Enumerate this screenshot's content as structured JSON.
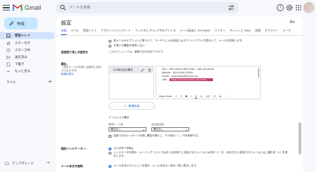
{
  "app": {
    "name": "Gmail",
    "brand_colors": [
      "#ea4335",
      "#4285f4",
      "#34a853",
      "#fbbc04"
    ]
  },
  "search": {
    "placeholder": "メールを検索"
  },
  "sidebar": {
    "compose_label": "作成",
    "items": [
      {
        "label": "受信トレイ",
        "icon": "inbox-icon",
        "active": true
      },
      {
        "label": "スター付き",
        "icon": "star-icon"
      },
      {
        "label": "スヌーズ中",
        "icon": "clock-icon"
      },
      {
        "label": "送信済み",
        "icon": "send-icon"
      },
      {
        "label": "下書き",
        "icon": "draft-icon"
      },
      {
        "label": "もっと見る",
        "icon": "chevron-down-icon"
      }
    ],
    "labels_heading": "ラベル",
    "labels_add": "+",
    "upgrade_label": "アップグレード"
  },
  "main": {
    "title": "設定",
    "tabs": [
      "全般",
      "ラベル",
      "受信トレイ",
      "アカウントとインポート",
      "フィルタとブロック中のアドレス",
      "メール転送と POP/IMAP",
      "アドオン",
      "チャットと Meet",
      "詳細",
      "オフライン",
      "テーマ"
    ],
    "active_tab": "全般",
    "top_option_1": "各メールのオプションに基づいて、ユーザーによる返信にはスマートリプライを表示して、メールを送信します。",
    "top_option_2": "予測入力機能を使用しない",
    "undo_label": "送信取り消しの設定を",
    "undo_link_text": "このセクションでは、編集方法を設定できます。",
    "signature_label": "署名:",
    "signature_sub": "（送信メールの末尾に自動的に追加される文字列）",
    "signature_sub2": "詳細を表示",
    "signature_name": "GIG株式会社署名",
    "signature_lines": [
      "TEL：000-0000-0000 FAX：000-00-0000",
      "Mobile：000-0000-0000",
      "Email：xxxxxxxx@xxxxx.xx",
      "URL："
    ],
    "signature_selected": "https://xxxxx.xxxxx.xx/xxxxx",
    "toolbar": [
      "Sans Serif",
      "T",
      "B",
      "I",
      "U",
      "A",
      "GO",
      "☐",
      "≡",
      "⋮"
    ],
    "create_new": "新規作成",
    "defaults_heading": "デフォルトの署名",
    "new_mail_label": "新規メール用",
    "reply_label": "返信/転送用",
    "new_mail_value": "署名なし",
    "reply_value": "署名なし",
    "insert_sig_option": "返信で元のメッセージの前に署名を挿入し、その前の「--」行を削除する",
    "personal_label": "個別インジケーター:",
    "personal_opt1": "インジケータなし",
    "personal_opt2": "インジケータを表示 - メーリング リストではなく自分宛てに送信されたメールには矢印（›）を、自分だけに送信されたメールには二重矢印（»）を表示します。",
    "snippet_label": "メール本文の抜粋:",
    "snippet_opt": "メール本文のプレビューを表示 - メール本文の一部を一覧に表示します。"
  }
}
